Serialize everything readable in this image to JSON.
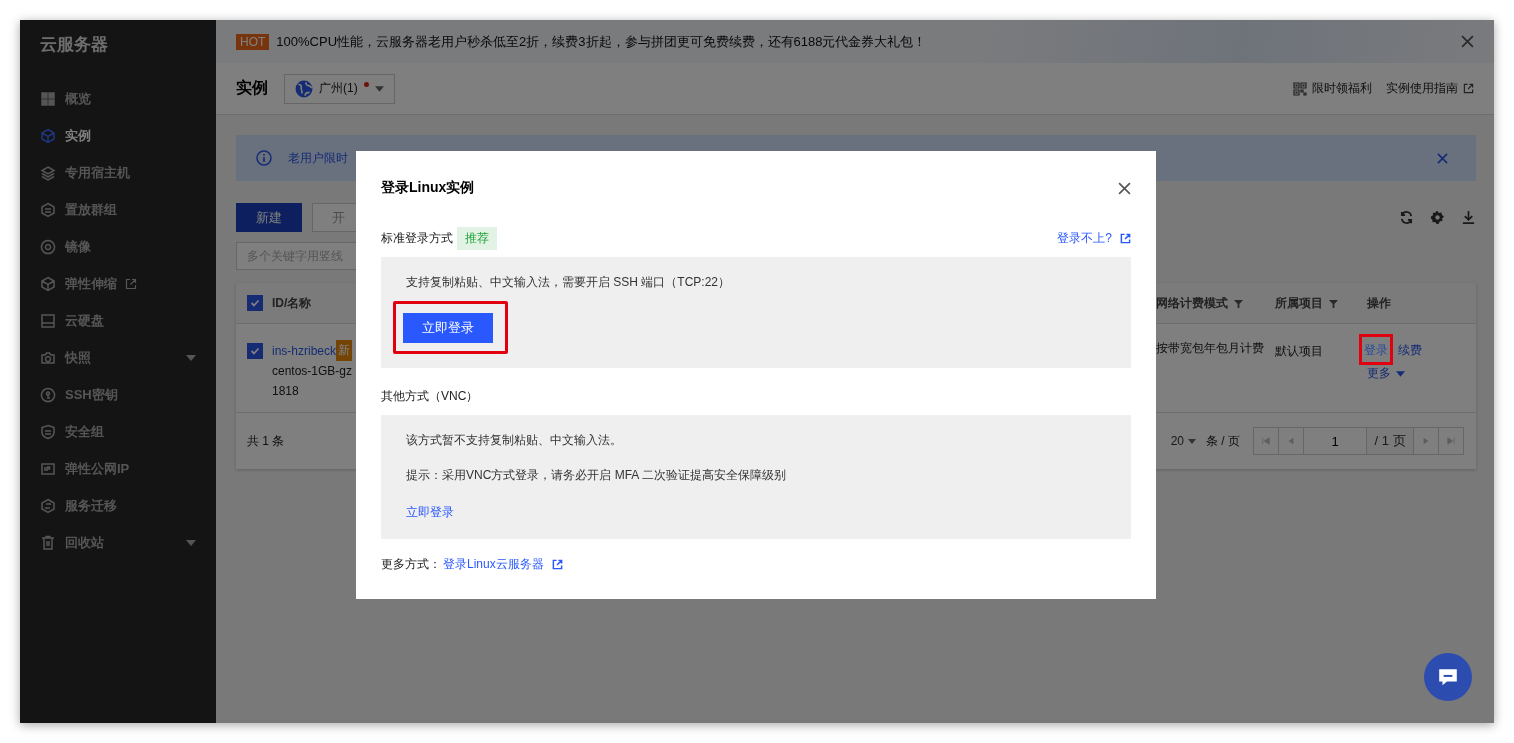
{
  "sidebar": {
    "title": "云服务器",
    "items": [
      {
        "label": "概览",
        "selected": false,
        "submenu": false,
        "external": false
      },
      {
        "label": "实例",
        "selected": true,
        "submenu": false,
        "external": false
      },
      {
        "label": "专用宿主机",
        "selected": false,
        "submenu": false,
        "external": false
      },
      {
        "label": "置放群组",
        "selected": false,
        "submenu": false,
        "external": false
      },
      {
        "label": "镜像",
        "selected": false,
        "submenu": false,
        "external": false
      },
      {
        "label": "弹性伸缩",
        "selected": false,
        "submenu": false,
        "external": true
      },
      {
        "label": "云硬盘",
        "selected": false,
        "submenu": false,
        "external": false
      },
      {
        "label": "快照",
        "selected": false,
        "submenu": true,
        "external": false
      },
      {
        "label": "SSH密钥",
        "selected": false,
        "submenu": false,
        "external": false
      },
      {
        "label": "安全组",
        "selected": false,
        "submenu": false,
        "external": false
      },
      {
        "label": "弹性公网IP",
        "selected": false,
        "submenu": false,
        "external": false
      },
      {
        "label": "服务迁移",
        "selected": false,
        "submenu": false,
        "external": false
      },
      {
        "label": "回收站",
        "selected": false,
        "submenu": true,
        "external": false
      }
    ]
  },
  "banner": {
    "badge": "HOT",
    "text": "100%CPU性能，云服务器老用户秒杀低至2折，续费3折起，参与拼团更可免费续费，还有6188元代金券大礼包！"
  },
  "header": {
    "title": "实例",
    "region": "广州(1)",
    "links": [
      {
        "label": "限时领福利",
        "external": false
      },
      {
        "label": "实例使用指南",
        "external": true
      }
    ]
  },
  "alert": {
    "text": "老用户限时"
  },
  "toolbar": {
    "buttons": [
      {
        "label": "新建",
        "primary": true
      },
      {
        "label": "开",
        "primary": false
      }
    ]
  },
  "search": {
    "placeholder": "多个关键字用竖线"
  },
  "table": {
    "header_checked": true,
    "columns": [
      {
        "label": "ID/名称",
        "filter": false
      },
      {
        "label": "网络计费模式",
        "filter": true
      },
      {
        "label": "所属项目",
        "filter": true
      },
      {
        "label": "操作",
        "filter": false
      }
    ],
    "rows": [
      {
        "checked": true,
        "id": "ins-hzribeck",
        "badge": "新",
        "name_lines": [
          "centos-1GB-gz",
          "1818"
        ],
        "billing": "按带宽包年包月计费",
        "project": "默认项目",
        "actions": [
          {
            "label": "登录",
            "highlighted": true
          },
          {
            "label": "续费",
            "highlighted": false
          }
        ],
        "more": "更多"
      }
    ],
    "total": "共 1 条",
    "page_size": "20",
    "page_size_unit": "条 / 页",
    "page": "1",
    "page_total": "/ 1 页"
  },
  "dialog": {
    "title": "登录Linux实例",
    "sections": [
      {
        "label": "标准登录方式",
        "tag": "推荐",
        "help_link": "登录不上?",
        "lines": [
          "支持复制粘贴、中文输入法，需要开启 SSH 端口（TCP:22）"
        ],
        "action": "立即登录",
        "kind": "button",
        "highlighted": true
      },
      {
        "label": "其他方式（VNC）",
        "lines": [
          "该方式暂不支持复制粘贴、中文输入法。",
          "提示：采用VNC方式登录，请务必开启 MFA 二次验证提高安全保障级别"
        ],
        "action": "立即登录",
        "kind": "link",
        "highlighted": false
      }
    ],
    "more_label": "更多方式：",
    "more_link": "登录Linux云服务器"
  }
}
